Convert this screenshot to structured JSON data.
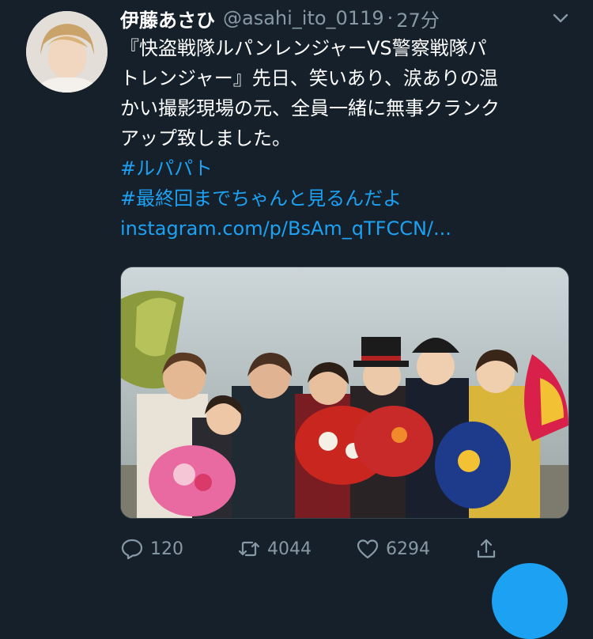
{
  "tweet": {
    "author_name": "伊藤あさひ",
    "handle": "@asahi_ito_0119",
    "separator": "·",
    "time": "27分",
    "text_lines": [
      "『快盗戦隊ルパンレンジャーVS警察戦隊パ",
      "トレンジャー』先日、笑いあり、涙ありの温",
      "かい撮影現場の元、全員一緒に無事クランク",
      "アップ致しました。"
    ],
    "hashtag1": "#ルパパト",
    "hashtag2": "#最終回までちゃんと見るんだよ",
    "url": "instagram.com/p/BsAm_qTFCCN/..."
  },
  "actions": {
    "reply_count": "120",
    "retweet_count": "4044",
    "like_count": "6294"
  },
  "colors": {
    "background": "#15202b",
    "link": "#1da1f2",
    "muted": "#8899a6"
  },
  "icons": [
    "avatar-photo",
    "chevron-down-icon",
    "reply-icon",
    "retweet-icon",
    "like-icon",
    "share-icon",
    "compose-fab"
  ]
}
